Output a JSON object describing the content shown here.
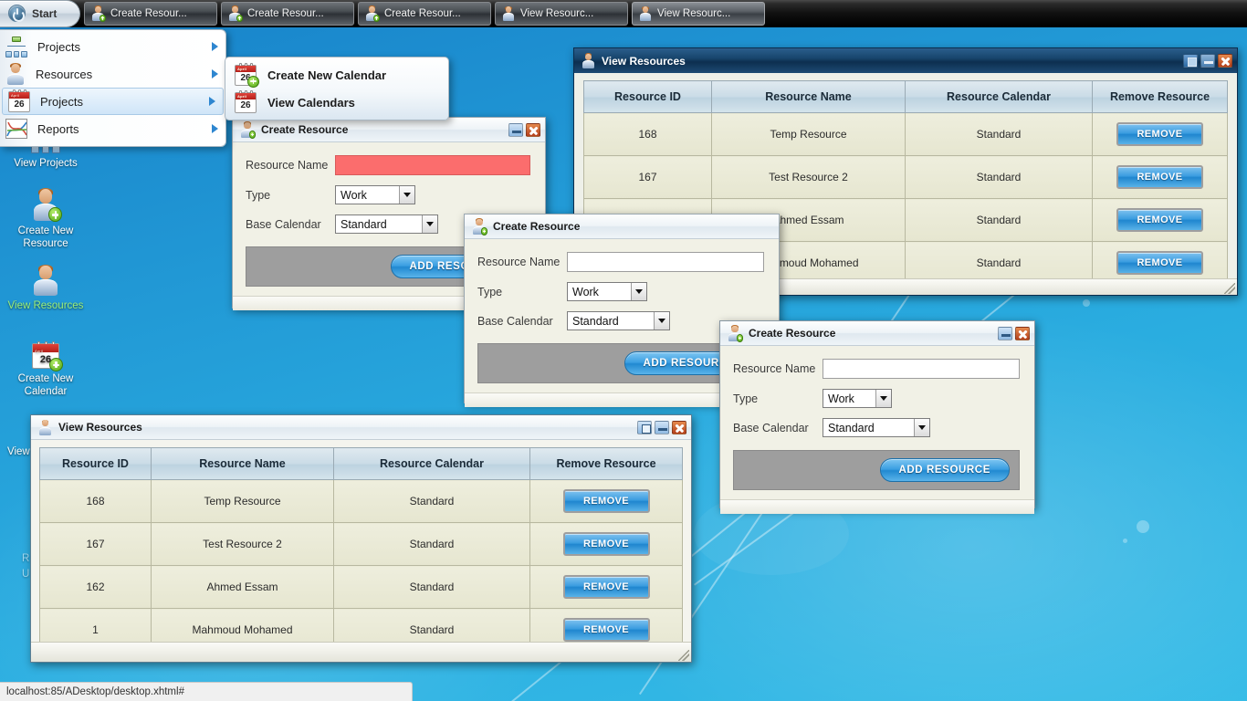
{
  "taskbar": {
    "start_label": "Start",
    "start_icon": "power-icon",
    "items": [
      {
        "label": "Create Resour...",
        "icon": "create-resource-icon",
        "active": false
      },
      {
        "label": "Create Resour...",
        "icon": "create-resource-icon",
        "active": false
      },
      {
        "label": "Create Resour...",
        "icon": "create-resource-icon",
        "active": false
      },
      {
        "label": "View Resourc...",
        "icon": "view-resource-icon",
        "active": false
      },
      {
        "label": "View Resourc...",
        "icon": "view-resource-icon",
        "active": true
      }
    ]
  },
  "start_menu": {
    "items": [
      {
        "label": "Projects",
        "icon": "org-chart-icon",
        "selected": false
      },
      {
        "label": "Resources",
        "icon": "person-icon",
        "selected": false
      },
      {
        "label": "Projects",
        "icon": "calendar-icon",
        "selected": true
      },
      {
        "label": "Reports",
        "icon": "chart-icon",
        "selected": false
      }
    ],
    "submenu": {
      "items": [
        {
          "label": "Create New Calendar",
          "icon": "calendar-add-icon"
        },
        {
          "label": "View Calendars",
          "icon": "calendar-icon"
        }
      ]
    }
  },
  "desktop_icons": [
    {
      "label": "View Projects",
      "icon": "org-chart-icon",
      "selected": false
    },
    {
      "label": "Create New Resource",
      "icon": "create-resource-icon",
      "selected": false
    },
    {
      "label": "View Resources",
      "icon": "view-resource-icon",
      "selected": true
    },
    {
      "label": "Create New Calendar",
      "icon": "calendar-add-icon",
      "selected": false
    },
    {
      "label": "View",
      "icon": "hidden-icon",
      "selected": false
    },
    {
      "label": "R\nU",
      "icon": "hidden-icon",
      "selected": false
    }
  ],
  "browser_status": {
    "url": "localhost:85/ADesktop/desktop.xhtml#"
  },
  "resources_table": {
    "columns": [
      "Resource ID",
      "Resource Name",
      "Resource Calendar",
      "Remove Resource"
    ],
    "rows": [
      {
        "id": "168",
        "name": "Temp Resource",
        "calendar": "Standard",
        "action": "REMOVE"
      },
      {
        "id": "167",
        "name": "Test Resource 2",
        "calendar": "Standard",
        "action": "REMOVE"
      },
      {
        "id": "162",
        "name": "Ahmed Essam",
        "calendar": "Standard",
        "action": "REMOVE"
      },
      {
        "id": "1",
        "name": "Mahmoud Mohamed",
        "calendar": "Standard",
        "action": "REMOVE"
      }
    ]
  },
  "windows": {
    "view_resources_top": {
      "title": "View Resources",
      "icon": "view-resource-icon",
      "controls": [
        "restore",
        "minimize",
        "close"
      ]
    },
    "view_resources_bottom": {
      "title": "View Resources",
      "icon": "view-resource-icon",
      "controls": [
        "restore",
        "minimize",
        "close"
      ]
    },
    "create_resource_back": {
      "title": "Create Resource",
      "icon": "create-resource-icon",
      "controls": [
        "minimize",
        "close"
      ],
      "fields": {
        "name_label": "Resource Name",
        "name_value": "",
        "name_error": true,
        "type_label": "Type",
        "type_value": "Work",
        "calendar_label": "Base Calendar",
        "calendar_value": "Standard"
      },
      "submit_label": "ADD RESOURCE"
    },
    "create_resource_mid": {
      "title": "Create Resource",
      "icon": "create-resource-icon",
      "controls": [],
      "fields": {
        "name_label": "Resource Name",
        "name_value": "",
        "type_label": "Type",
        "type_value": "Work",
        "calendar_label": "Base Calendar",
        "calendar_value": "Standard"
      },
      "submit_label": "ADD RESOURCE"
    },
    "create_resource_front": {
      "title": "Create Resource",
      "icon": "create-resource-icon",
      "controls": [
        "minimize",
        "close"
      ],
      "fields": {
        "name_label": "Resource Name",
        "name_value": "",
        "type_label": "Type",
        "type_value": "Work",
        "calendar_label": "Base Calendar",
        "calendar_value": "Standard"
      },
      "submit_label": "ADD RESOURCE"
    }
  },
  "colors": {
    "desktop_blue": "#229ad6",
    "titlebar_dark": "#17456c",
    "accent_button": "#2189d1",
    "error_field": "#fb6d6d",
    "selected_label": "#9cf07a"
  }
}
